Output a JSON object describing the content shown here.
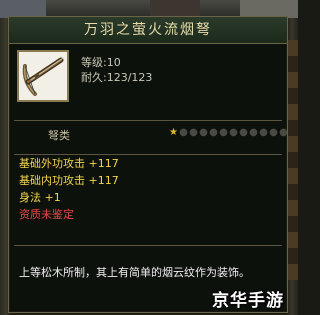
{
  "item": {
    "name": "万羽之萤火流烟弩",
    "level": "等级:10",
    "durability": "耐久:123/123",
    "type": "弩类",
    "stars": {
      "filled": 1,
      "total": 12
    },
    "attributes": [
      "基础外功攻击 +117",
      "基础内功攻击 +117",
      "身法 +1",
      "资质未鉴定"
    ],
    "description": "上等松木所制，其上有简单的烟云纹作为装饰。"
  },
  "colors": {
    "title": "#e6dca8",
    "attribute": "#f4d64a",
    "unidentified": "#e84848",
    "star_on": "#e0b830"
  },
  "icons": {
    "item": "crossbow-icon",
    "star": "star-icon"
  },
  "watermark": "京华手游"
}
